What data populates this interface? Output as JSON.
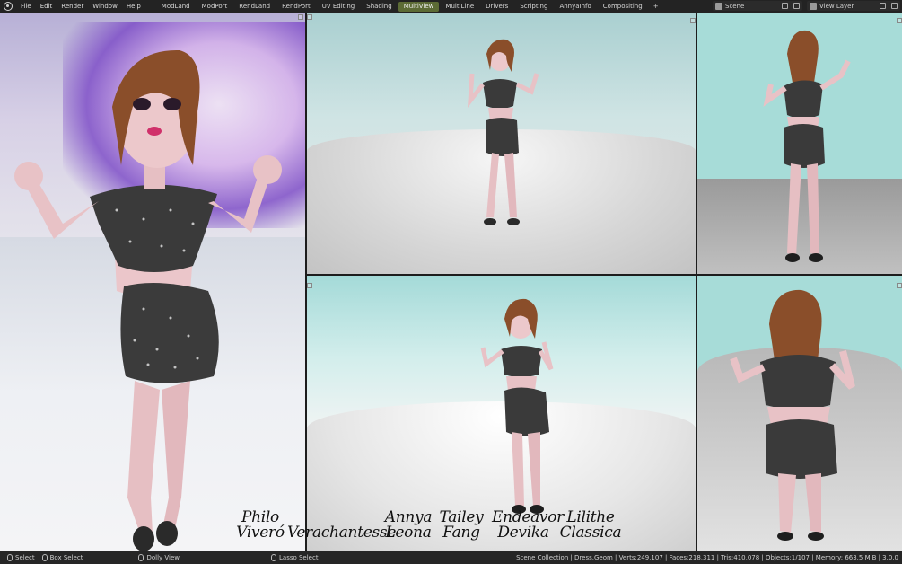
{
  "topbar": {
    "menu": [
      "File",
      "Edit",
      "Render",
      "Window",
      "Help"
    ],
    "workspaces": [
      "ModLand",
      "ModPort",
      "RendLand",
      "RendPort",
      "UV Editing",
      "Shading",
      "MultiView",
      "MultiLine",
      "Drivers",
      "Scripting",
      "AnnyaInfo",
      "Compositing"
    ],
    "active_workspace": "MultiView",
    "add_tab": "+",
    "scene": "Scene",
    "view_layer": "View Layer"
  },
  "credits": [
    {
      "line1": "Philo",
      "line2": "Viveró"
    },
    {
      "line1": "",
      "line2": "Verachantesse"
    },
    {
      "line1": "Annya",
      "line2": "Leona"
    },
    {
      "line1": "Tailey",
      "line2": "Fang"
    },
    {
      "line1": "Endeavor",
      "line2": "Devika"
    },
    {
      "line1": "Lilithe",
      "line2": "Classica"
    }
  ],
  "statusbar": {
    "select": "Select",
    "box_select": "Box Select",
    "dolly_view": "Dolly View",
    "lasso_select": "Lasso Select",
    "stats": "Scene Collection | Dress.Geom | Verts:249,107 | Faces:218,311 | Tris:410,078 | Objects:1/107 | Memory: 663.5 MiB | 3.0.0"
  },
  "colors": {
    "active_tab": "#5c6b35",
    "topbar_bg": "#232323",
    "statusbar_bg": "#262626",
    "skin": "#e8c2c6",
    "hair": "#8a4e2a",
    "dress": "#3a3a3a"
  }
}
